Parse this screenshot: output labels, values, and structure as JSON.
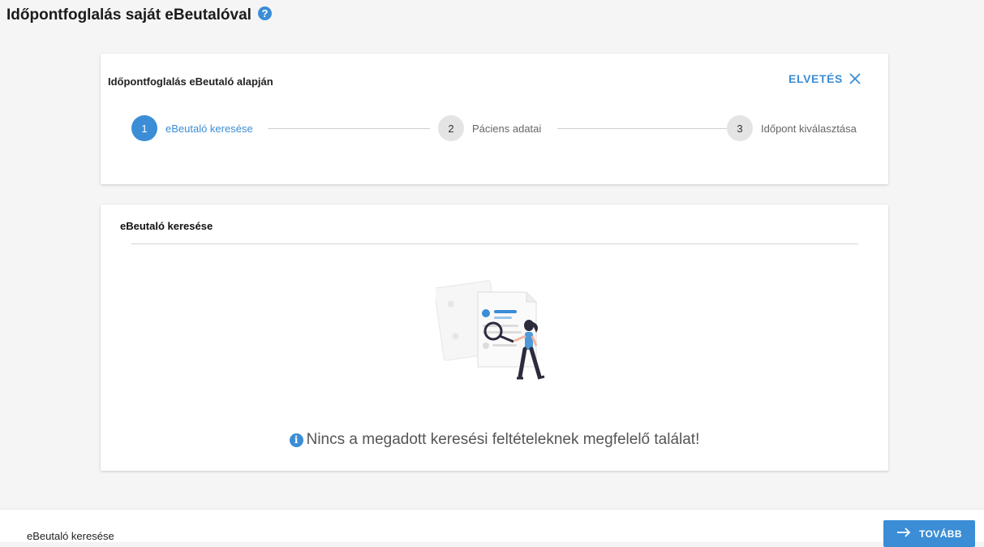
{
  "page": {
    "title": "Időpontfoglalás saját eBeutalóval",
    "help_icon": "?"
  },
  "wizard": {
    "title": "Időpontfoglalás eBeutaló alapján",
    "discard_label": "ELVETÉS",
    "steps": [
      {
        "number": "1",
        "label": "eBeutaló keresése",
        "state": "active"
      },
      {
        "number": "2",
        "label": "Páciens adatai",
        "state": "pending"
      },
      {
        "number": "3",
        "label": "Időpont kiválasztása",
        "state": "pending"
      }
    ]
  },
  "search": {
    "title": "eBeutaló keresése",
    "empty_message": "Nincs a megadott keresési feltételeknek megfelelő találat!",
    "info_icon": "i"
  },
  "footer": {
    "current_step_label": "eBeutaló keresése",
    "next_label": "TOVÁBB"
  },
  "colors": {
    "accent": "#3b8dd6",
    "background": "#f5f5f5"
  }
}
